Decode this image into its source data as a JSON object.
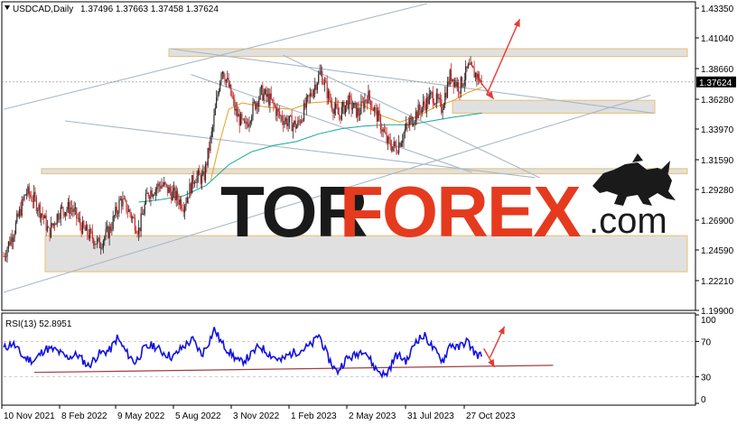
{
  "header": {
    "symbol": "USDCAD,Daily",
    "ohlc": "1.37496 1.37663 1.37458 1.37624"
  },
  "rsi": {
    "label": "RSI(13) 52.8951"
  },
  "watermark": {
    "brand_dark": "TOR",
    "brand_red": "FOREX",
    "suffix": ".com"
  },
  "colors": {
    "bull": "#2b2b2b",
    "bear": "#c62828",
    "ma_fast": "#e6a020",
    "ma_slow": "#14a89a",
    "rsi_line": "#1010e0",
    "trendline": "#a8b8c8",
    "zone_fill": "#e0e0e0",
    "zone_border": "#e8c070",
    "arrow": "#e53935",
    "rsi_support": "#a04040"
  },
  "chart_data": [
    {
      "type": "candlestick",
      "title": "USDCAD,Daily",
      "x_ticks": [
        "10 Nov 2021",
        "8 Feb 2022",
        "9 May 2022",
        "5 Aug 2022",
        "3 Nov 2022",
        "1 Feb 2023",
        "2 May 2023",
        "31 Jul 2023",
        "27 Oct 2023"
      ],
      "y_ticks": [
        1.4335,
        1.4104,
        1.3866,
        1.3628,
        1.3397,
        1.3159,
        1.2928,
        1.269,
        1.2459,
        1.2221,
        1.199
      ],
      "ylim": [
        1.199,
        1.437
      ],
      "current_price": 1.37624,
      "price_path": [
        [
          0,
          1.241
        ],
        [
          12,
          1.262
        ],
        [
          25,
          1.291
        ],
        [
          34,
          1.285
        ],
        [
          44,
          1.272
        ],
        [
          50,
          1.259
        ],
        [
          62,
          1.276
        ],
        [
          75,
          1.279
        ],
        [
          88,
          1.262
        ],
        [
          98,
          1.256
        ],
        [
          106,
          1.25
        ],
        [
          118,
          1.262
        ],
        [
          130,
          1.285
        ],
        [
          140,
          1.275
        ],
        [
          150,
          1.261
        ],
        [
          160,
          1.29
        ],
        [
          175,
          1.297
        ],
        [
          190,
          1.288
        ],
        [
          200,
          1.281
        ],
        [
          212,
          1.303
        ],
        [
          222,
          1.301
        ],
        [
          232,
          1.34
        ],
        [
          242,
          1.388
        ],
        [
          250,
          1.372
        ],
        [
          258,
          1.352
        ],
        [
          268,
          1.34
        ],
        [
          276,
          1.355
        ],
        [
          286,
          1.368
        ],
        [
          296,
          1.362
        ],
        [
          306,
          1.35
        ],
        [
          316,
          1.345
        ],
        [
          326,
          1.342
        ],
        [
          340,
          1.365
        ],
        [
          352,
          1.384
        ],
        [
          362,
          1.362
        ],
        [
          372,
          1.35
        ],
        [
          382,
          1.361
        ],
        [
          394,
          1.352
        ],
        [
          404,
          1.366
        ],
        [
          416,
          1.348
        ],
        [
          426,
          1.329
        ],
        [
          436,
          1.325
        ],
        [
          446,
          1.339
        ],
        [
          456,
          1.35
        ],
        [
          466,
          1.358
        ],
        [
          476,
          1.366
        ],
        [
          486,
          1.356
        ],
        [
          496,
          1.382
        ],
        [
          506,
          1.372
        ],
        [
          516,
          1.387
        ],
        [
          524,
          1.382
        ],
        [
          531,
          1.376
        ]
      ],
      "ma_fast": [
        [
          230,
          1.3
        ],
        [
          240,
          1.33
        ],
        [
          250,
          1.355
        ],
        [
          265,
          1.36
        ],
        [
          280,
          1.358
        ],
        [
          300,
          1.356
        ],
        [
          320,
          1.355
        ],
        [
          340,
          1.36
        ],
        [
          360,
          1.361
        ],
        [
          380,
          1.36
        ],
        [
          400,
          1.358
        ],
        [
          420,
          1.35
        ],
        [
          440,
          1.345
        ],
        [
          460,
          1.35
        ],
        [
          480,
          1.357
        ],
        [
          500,
          1.362
        ],
        [
          515,
          1.368
        ],
        [
          531,
          1.372
        ]
      ],
      "ma_slow": [
        [
          150,
          1.283
        ],
        [
          175,
          1.285
        ],
        [
          200,
          1.288
        ],
        [
          225,
          1.296
        ],
        [
          250,
          1.312
        ],
        [
          275,
          1.322
        ],
        [
          300,
          1.327
        ],
        [
          325,
          1.33
        ],
        [
          350,
          1.336
        ],
        [
          375,
          1.34
        ],
        [
          400,
          1.342
        ],
        [
          425,
          1.343
        ],
        [
          450,
          1.343
        ],
        [
          475,
          1.346
        ],
        [
          500,
          1.349
        ],
        [
          531,
          1.352
        ]
      ],
      "zones": [
        [
          1.396,
          1.402
        ],
        [
          1.352,
          1.362
        ],
        [
          1.305,
          1.309
        ],
        [
          1.229,
          1.257
        ]
      ],
      "trendlines": [
        [
          [
            0,
            1.355
          ],
          [
            470,
            1.437
          ]
        ],
        [
          [
            0,
            1.213
          ],
          [
            718,
            1.366
          ]
        ],
        [
          [
            185,
            1.402
          ],
          [
            722,
            1.352
          ]
        ],
        [
          [
            208,
            1.382
          ],
          [
            520,
            1.306
          ]
        ],
        [
          [
            68,
            1.346
          ],
          [
            590,
            1.302
          ]
        ],
        [
          [
            310,
            1.397
          ],
          [
            595,
            1.302
          ]
        ]
      ],
      "arrows": [
        [
          [
            536,
            1.366
          ],
          [
            573,
            1.425
          ]
        ],
        [
          [
            525,
            1.38
          ],
          [
            544,
            1.363
          ]
        ]
      ]
    },
    {
      "type": "line",
      "title": "RSI(13) 52.8951",
      "y_ticks": [
        100,
        70,
        30,
        0
      ],
      "ylim": [
        0,
        100
      ],
      "levels": [
        70,
        30
      ],
      "rsi_path": [
        [
          0,
          62
        ],
        [
          10,
          68
        ],
        [
          22,
          52
        ],
        [
          34,
          48
        ],
        [
          46,
          62
        ],
        [
          58,
          60
        ],
        [
          70,
          52
        ],
        [
          82,
          55
        ],
        [
          94,
          42
        ],
        [
          106,
          56
        ],
        [
          118,
          60
        ],
        [
          126,
          74
        ],
        [
          136,
          58
        ],
        [
          146,
          46
        ],
        [
          156,
          62
        ],
        [
          166,
          66
        ],
        [
          176,
          58
        ],
        [
          188,
          52
        ],
        [
          198,
          63
        ],
        [
          210,
          72
        ],
        [
          220,
          55
        ],
        [
          228,
          70
        ],
        [
          234,
          84
        ],
        [
          242,
          68
        ],
        [
          252,
          57
        ],
        [
          262,
          46
        ],
        [
          272,
          52
        ],
        [
          284,
          65
        ],
        [
          296,
          55
        ],
        [
          308,
          48
        ],
        [
          318,
          56
        ],
        [
          330,
          60
        ],
        [
          342,
          66
        ],
        [
          350,
          78
        ],
        [
          360,
          52
        ],
        [
          370,
          35
        ],
        [
          380,
          50
        ],
        [
          390,
          54
        ],
        [
          400,
          62
        ],
        [
          412,
          40
        ],
        [
          424,
          31
        ],
        [
          436,
          55
        ],
        [
          448,
          48
        ],
        [
          458,
          72
        ],
        [
          468,
          76
        ],
        [
          478,
          60
        ],
        [
          488,
          48
        ],
        [
          496,
          68
        ],
        [
          504,
          62
        ],
        [
          514,
          71
        ],
        [
          524,
          56
        ],
        [
          531,
          53
        ]
      ],
      "support_line": [
        [
          34,
          35
        ],
        [
          610,
          43
        ]
      ],
      "arrows": [
        [
          [
            540,
            52
          ],
          [
            556,
            87
          ]
        ],
        [
          [
            533,
            62
          ],
          [
            545,
            41
          ]
        ]
      ]
    }
  ]
}
